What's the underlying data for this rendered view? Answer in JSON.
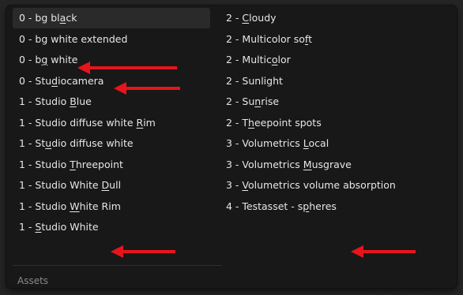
{
  "background": {
    "search_value": "0 - bg black",
    "icon": "file-icon"
  },
  "menu": {
    "column1": [
      {
        "pre": "0 - bg bl",
        "u": "a",
        "post": "ck"
      },
      {
        "pre": "0 - bg white extended",
        "u": "",
        "post": ""
      },
      {
        "pre": "0 - b",
        "u": "g",
        "post": " white"
      },
      {
        "pre": "0 - Stu",
        "u": "d",
        "post": "iocamera"
      },
      {
        "pre": "1 - Studio ",
        "u": "B",
        "post": "lue"
      },
      {
        "pre": "1 - Studio diffuse white ",
        "u": "R",
        "post": "im"
      },
      {
        "pre": "1 - St",
        "u": "u",
        "post": "dio diffuse white"
      },
      {
        "pre": "1 - Studio ",
        "u": "T",
        "post": "hreepoint"
      },
      {
        "pre": "1 - Studio White ",
        "u": "D",
        "post": "ull"
      },
      {
        "pre": "1 - Studio ",
        "u": "W",
        "post": "hite Rim"
      },
      {
        "pre": "1 - ",
        "u": "S",
        "post": "tudio White"
      }
    ],
    "column2": [
      {
        "pre": "2 - ",
        "u": "C",
        "post": "loudy"
      },
      {
        "pre": "2 - Multicolor so",
        "u": "f",
        "post": "t"
      },
      {
        "pre": "2 - Multic",
        "u": "o",
        "post": "lor"
      },
      {
        "pre": "2 - Sunlight",
        "u": "",
        "post": ""
      },
      {
        "pre": "2 - Su",
        "u": "n",
        "post": "rise"
      },
      {
        "pre": "2 - T",
        "u": "h",
        "post": "eepoint spots"
      },
      {
        "pre": "3 - Volumetrics ",
        "u": "L",
        "post": "ocal"
      },
      {
        "pre": "3 - Volumetrics ",
        "u": "M",
        "post": "usgrave"
      },
      {
        "pre": "3 - ",
        "u": "V",
        "post": "olumetrics volume absorption"
      },
      {
        "pre": "4 - Testasset - s",
        "u": "p",
        "post": "heres"
      }
    ],
    "section_label": "Assets"
  },
  "colors": {
    "arrow": "#e8141c",
    "menu_bg": "#181818",
    "text": "#e6e6e6",
    "section": "#8a8a8a"
  }
}
